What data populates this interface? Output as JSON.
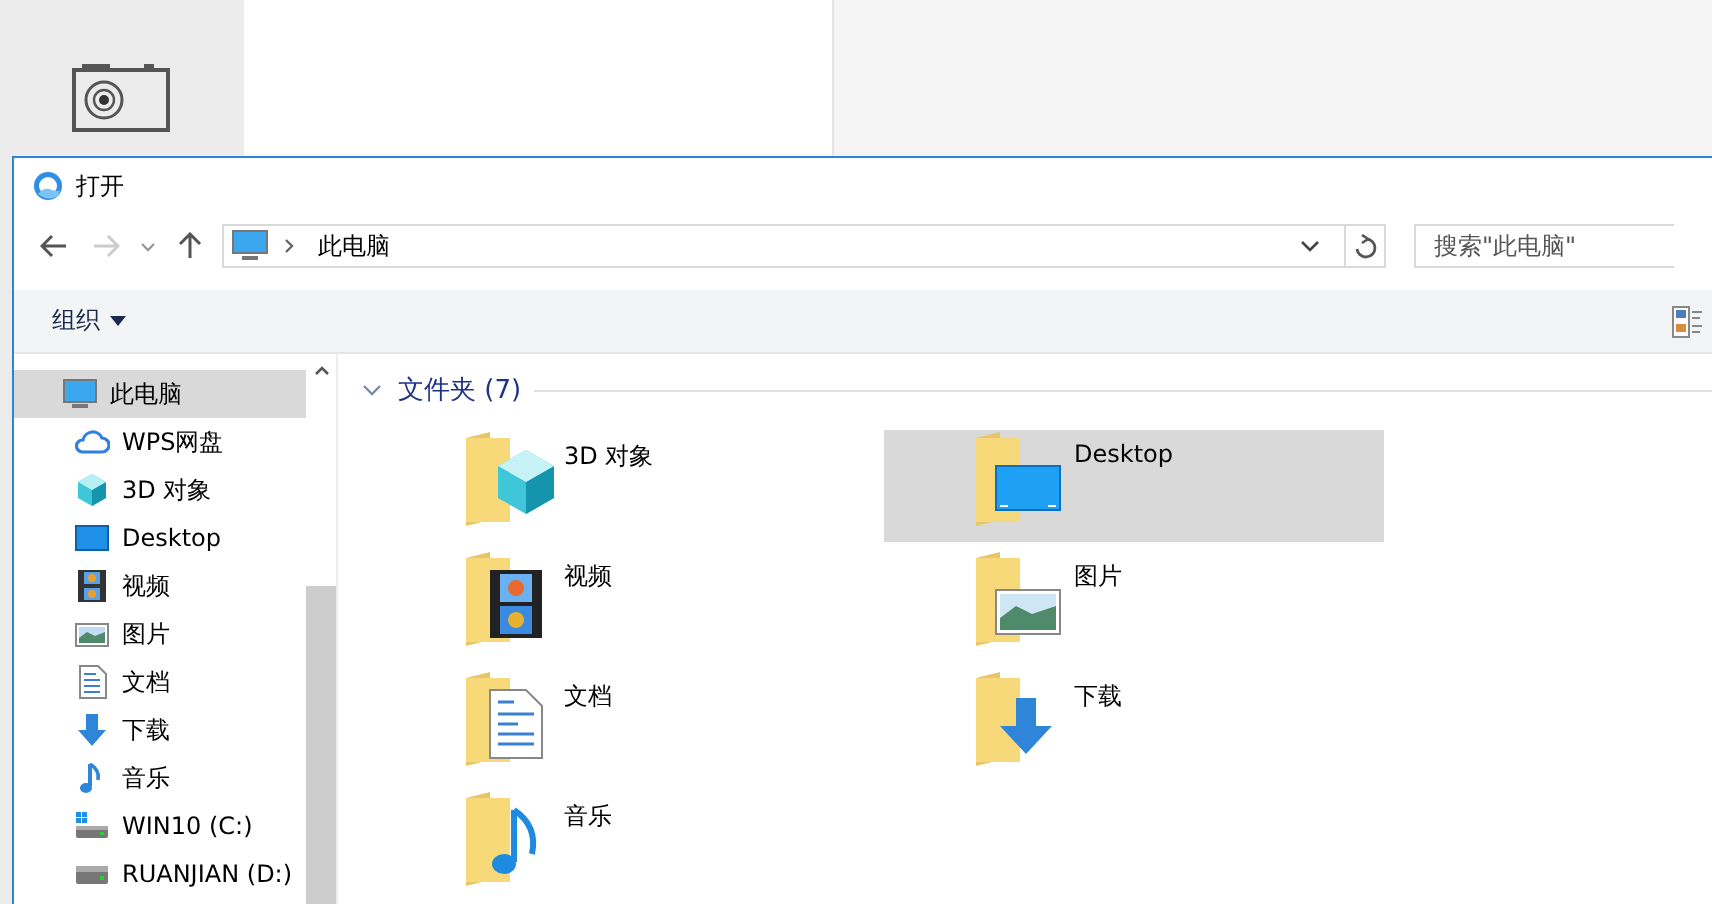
{
  "dialog": {
    "title": "打开",
    "address": {
      "path": "此电脑"
    },
    "search": {
      "placeholder": "搜索\"此电脑\""
    },
    "toolbar": {
      "organize": "组织"
    },
    "sidebar": {
      "items": [
        {
          "label": "此电脑",
          "kind": "pc",
          "selected": true,
          "child": false
        },
        {
          "label": "WPS网盘",
          "kind": "cloud",
          "selected": false,
          "child": true
        },
        {
          "label": "3D 对象",
          "kind": "cube",
          "selected": false,
          "child": true
        },
        {
          "label": "Desktop",
          "kind": "desktop",
          "selected": false,
          "child": true
        },
        {
          "label": "视频",
          "kind": "video",
          "selected": false,
          "child": true
        },
        {
          "label": "图片",
          "kind": "picture",
          "selected": false,
          "child": true
        },
        {
          "label": "文档",
          "kind": "document",
          "selected": false,
          "child": true
        },
        {
          "label": "下载",
          "kind": "download",
          "selected": false,
          "child": true
        },
        {
          "label": "音乐",
          "kind": "music",
          "selected": false,
          "child": true
        },
        {
          "label": "WIN10 (C:)",
          "kind": "sysdrive",
          "selected": false,
          "child": true
        },
        {
          "label": "RUANJIAN (D:)",
          "kind": "drive",
          "selected": false,
          "child": true
        }
      ]
    },
    "section": {
      "title": "文件夹 (7)",
      "expanded": true
    },
    "folders": [
      {
        "label": "3D 对象",
        "kind": "cube",
        "selected": false
      },
      {
        "label": "Desktop",
        "kind": "desktop",
        "selected": true
      },
      {
        "label": "视频",
        "kind": "video",
        "selected": false
      },
      {
        "label": "图片",
        "kind": "picture",
        "selected": false
      },
      {
        "label": "文档",
        "kind": "document",
        "selected": false
      },
      {
        "label": "下载",
        "kind": "download",
        "selected": false
      },
      {
        "label": "音乐",
        "kind": "music",
        "selected": false
      }
    ]
  }
}
